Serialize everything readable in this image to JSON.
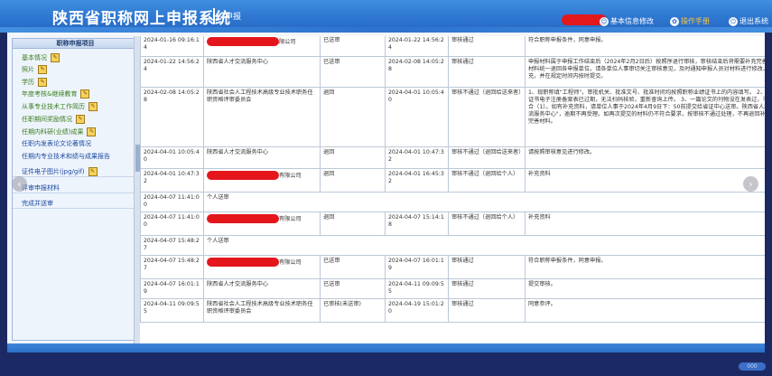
{
  "header": {
    "title": "陕西省职称网上申报系统",
    "subtitle": "申报",
    "nav": {
      "profile": "基本信息修改",
      "manual": "操作手册",
      "logout": "退出系统"
    }
  },
  "sidebar": {
    "title": "职称申报项目",
    "items": [
      {
        "label": "基本情况",
        "edit": true
      },
      {
        "label": "照片",
        "edit": true
      },
      {
        "label": "学历",
        "edit": true
      },
      {
        "label": "年度考核&继续教育",
        "edit": true
      },
      {
        "label": "从事专业技术工作简历",
        "edit": true
      },
      {
        "label": "任职期间奖励情况",
        "edit": true
      },
      {
        "label": "任期内科研(业绩)成果",
        "edit": true
      },
      {
        "label": "任职内发表论文论著情况",
        "edit": false
      },
      {
        "label": "任期内专业技术和绩与成果报告",
        "edit": false
      },
      {
        "label": "证件电子图片(jpg/gif)",
        "edit": true
      },
      {
        "label": "评审申报材料",
        "edit": false
      },
      {
        "label": "完成并送审",
        "edit": false
      }
    ]
  },
  "rows": [
    {
      "date": "2024-01-16 09:16:14",
      "org_suffix": "限公司",
      "org_redacted": true,
      "status": "已送审",
      "date2": "2024-01-22 14:56:24",
      "result": "审核通过",
      "opinion": "符合职称申报条件，同意申报。"
    },
    {
      "date": "2024-01-22 14:56:24",
      "org": "陕西省人才交流服务中心",
      "status": "已送审",
      "date2": "2024-02-08 14:05:28",
      "result": "审核通过",
      "opinion": "申报材料属于申报工作结束后（2024年2月2日后）按照序退行审核，审核结束后将需要补充完善的材料统一退回各申报单位，请各单位人事审切关注审核意见，及时通知申报人员对材料进行修改、补充，并在规定时间内按时提交。"
    },
    {
      "date": "2024-02-08 14:05:28",
      "org": "陕西省社会人工程技术高级专业技术职务任职资格评审委员会",
      "status": "退回",
      "date2": "2024-04-01 10:05:40",
      "result": "审核不通过（退回给送来者）",
      "opinion": "1、现职称填\"工程师\"，审批机关、批准文号、批准时间均按照职称业绩证书上的内容填写。 2、学历证书电子注册备案表已过期，无法扫码核验，重新查询上传。 3、一篇论文的刊物没在发表过，不符合（1）。如有补充资料，请单位人事于2024年4月9日下：50前提交给省证中心送审。陕西省人才交流服务中心\"，逾期不再受理。如再次提交的材料仍不符合要求，按审核不通过处理，不再退回补充或完善材料。"
    },
    {
      "date": "2024-04-01 10:05:40",
      "org": "陕西省人才交流服务中心",
      "status": "退回",
      "date2": "2024-04-01 10:47:32",
      "result": "审核不通过（退回给送来者）",
      "opinion": "请按照审核意见进行修改。"
    },
    {
      "date": "2024-04-01 10:47:32",
      "org_suffix": "有限公司",
      "org_redacted": true,
      "status": "退回",
      "date2": "2024-04-01 16:45:32",
      "result": "审核不通过（退回给个人）",
      "opinion": "补充资料"
    },
    {
      "date": "2024-04-07 11:41:00",
      "org": "个人送审",
      "span": true
    },
    {
      "date": "2024-04-07 11:41:00",
      "org_suffix": "有限公司",
      "org_redacted": true,
      "status": "退回",
      "date2": "2024-04-07 15:14:18",
      "result": "审核不通过（退回给个人）",
      "opinion": "补充资料"
    },
    {
      "date": "2024-04-07 15:48:27",
      "org": "个人送审",
      "span": true
    },
    {
      "date": "2024-04-07 15:48:27",
      "org_suffix": "有限公司",
      "org_redacted": true,
      "status": "已送审",
      "date2": "2024-04-07 16:01:19",
      "result": "审核通过",
      "opinion": "符合职称申报条件，同意申报。"
    },
    {
      "date": "2024-04-07 16:01:19",
      "org": "陕西省人才交流服务中心",
      "status": "已送审",
      "date2": "2024-04-11 09:09:55",
      "result": "审核通过",
      "opinion": "提交审核。"
    },
    {
      "date": "2024-04-11 09:09:55",
      "org": "陕西省社会人工程技术高级专业技术职务任职资格评审委员会",
      "status": "已审核(未送审)",
      "date2": "2024-04-19 15:01:20",
      "result": "审核通过",
      "opinion": "同意参评。"
    }
  ],
  "footer_badge": "000",
  "colors": {
    "header": "#2f78d2",
    "redact": "#e4161c",
    "sidebar_green": "#3a7d1e"
  }
}
